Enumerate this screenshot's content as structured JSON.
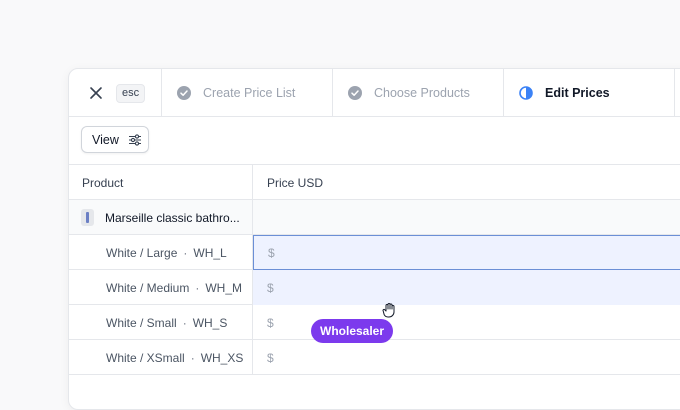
{
  "header": {
    "esc_label": "esc",
    "steps": [
      {
        "label": "Create Price List",
        "state": "complete"
      },
      {
        "label": "Choose Products",
        "state": "complete"
      },
      {
        "label": "Edit Prices",
        "state": "active"
      }
    ]
  },
  "toolbar": {
    "view_label": "View"
  },
  "table": {
    "columns": [
      "Product",
      "Price USD"
    ],
    "group": {
      "name": "Marseille classic bathro..."
    },
    "rows": [
      {
        "variant": "White / Large",
        "sku": "WH_L",
        "price": "$"
      },
      {
        "variant": "White / Medium",
        "sku": "WH_M",
        "price": "$"
      },
      {
        "variant": "White / Small",
        "sku": "WH_S",
        "price": "$"
      },
      {
        "variant": "White / XSmall",
        "sku": "WH_XS",
        "price": "$"
      }
    ],
    "separator": "·"
  },
  "tooltip": {
    "label": "Wholesaler",
    "color": "#7c3aed"
  },
  "colors": {
    "accent": "#6b8fd6",
    "selected_bg": "#eef2ff"
  }
}
